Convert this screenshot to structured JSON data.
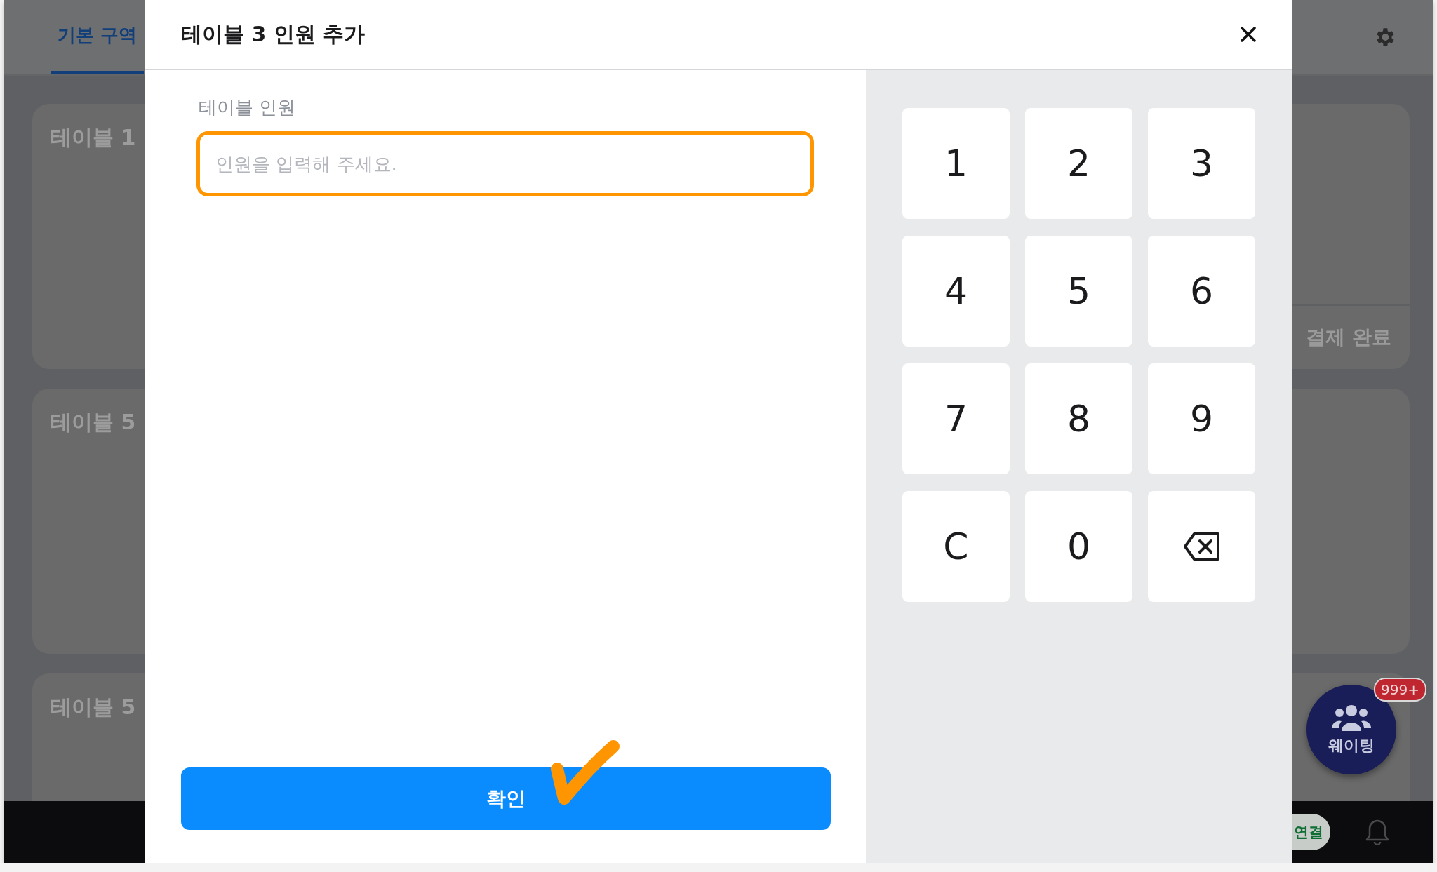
{
  "background": {
    "tabs": [
      {
        "label": "기본 구역",
        "selected": true
      }
    ],
    "left_tables": [
      {
        "title": "테이블 1"
      },
      {
        "title": "테이블 5"
      },
      {
        "title": "테이블 5"
      }
    ],
    "right_tables": [
      {
        "status": "결제 완료"
      }
    ],
    "bottom_bar": {
      "connection": "연결"
    },
    "waiting_button": {
      "label": "웨이팅",
      "badge": "999+"
    }
  },
  "modal": {
    "title": "테이블 3 인원 추가",
    "field": {
      "label": "테이블 인원",
      "placeholder": "인원을 입력해 주세요.",
      "focused": true
    },
    "keypad": [
      {
        "kind": "digit",
        "label": "1"
      },
      {
        "kind": "digit",
        "label": "2"
      },
      {
        "kind": "digit",
        "label": "3"
      },
      {
        "kind": "digit",
        "label": "4"
      },
      {
        "kind": "digit",
        "label": "5"
      },
      {
        "kind": "digit",
        "label": "6"
      },
      {
        "kind": "digit",
        "label": "7"
      },
      {
        "kind": "digit",
        "label": "8"
      },
      {
        "kind": "digit",
        "label": "9"
      },
      {
        "kind": "clear",
        "label": "C"
      },
      {
        "kind": "digit",
        "label": "0"
      },
      {
        "kind": "backspace"
      }
    ],
    "confirm_button": "확인"
  }
}
